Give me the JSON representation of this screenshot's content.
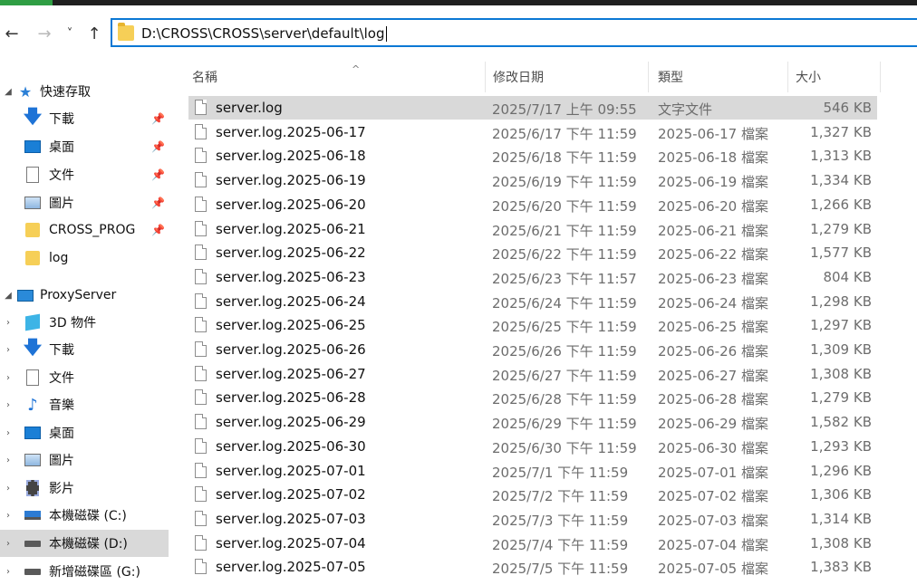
{
  "address": {
    "path": "D:\\CROSS\\CROSS\\server\\default\\log"
  },
  "nav": {
    "back": "←",
    "forward": "→",
    "recent": "˅",
    "up": "↑"
  },
  "columns": {
    "name": "名稱",
    "date": "修改日期",
    "type": "類型",
    "size": "大小"
  },
  "sidebar": {
    "quick_access": "快速存取",
    "quick_items": [
      {
        "label": "下載",
        "icon": "download-icon",
        "pinned": true
      },
      {
        "label": "桌面",
        "icon": "desktop-icon",
        "pinned": true
      },
      {
        "label": "文件",
        "icon": "documents-icon",
        "pinned": true
      },
      {
        "label": "圖片",
        "icon": "pictures-icon",
        "pinned": true
      },
      {
        "label": "CROSS_PROG",
        "icon": "folder-icon",
        "pinned": true
      },
      {
        "label": "log",
        "icon": "folder-icon",
        "pinned": false
      }
    ],
    "this_pc": "ProxyServer",
    "pc_items": [
      {
        "label": "3D 物件",
        "icon": "3d-objects-icon"
      },
      {
        "label": "下載",
        "icon": "download-icon"
      },
      {
        "label": "文件",
        "icon": "documents-icon"
      },
      {
        "label": "音樂",
        "icon": "music-icon"
      },
      {
        "label": "桌面",
        "icon": "desktop-icon"
      },
      {
        "label": "圖片",
        "icon": "pictures-icon"
      },
      {
        "label": "影片",
        "icon": "videos-icon"
      },
      {
        "label": "本機磁碟 (C:)",
        "icon": "drive-c-icon"
      },
      {
        "label": "本機磁碟 (D:)",
        "icon": "drive-icon"
      },
      {
        "label": "新增磁碟區 (G:)",
        "icon": "drive-icon"
      }
    ]
  },
  "files": [
    {
      "name": "server.log",
      "date": "2025/7/17 上午 09:55",
      "type": "文字文件",
      "size": "546 KB"
    },
    {
      "name": "server.log.2025-06-17",
      "date": "2025/6/17 下午 11:59",
      "type": "2025-06-17 檔案",
      "size": "1,327 KB"
    },
    {
      "name": "server.log.2025-06-18",
      "date": "2025/6/18 下午 11:59",
      "type": "2025-06-18 檔案",
      "size": "1,313 KB"
    },
    {
      "name": "server.log.2025-06-19",
      "date": "2025/6/19 下午 11:59",
      "type": "2025-06-19 檔案",
      "size": "1,334 KB"
    },
    {
      "name": "server.log.2025-06-20",
      "date": "2025/6/20 下午 11:59",
      "type": "2025-06-20 檔案",
      "size": "1,266 KB"
    },
    {
      "name": "server.log.2025-06-21",
      "date": "2025/6/21 下午 11:59",
      "type": "2025-06-21 檔案",
      "size": "1,279 KB"
    },
    {
      "name": "server.log.2025-06-22",
      "date": "2025/6/22 下午 11:59",
      "type": "2025-06-22 檔案",
      "size": "1,577 KB"
    },
    {
      "name": "server.log.2025-06-23",
      "date": "2025/6/23 下午 11:57",
      "type": "2025-06-23 檔案",
      "size": "804 KB"
    },
    {
      "name": "server.log.2025-06-24",
      "date": "2025/6/24 下午 11:59",
      "type": "2025-06-24 檔案",
      "size": "1,298 KB"
    },
    {
      "name": "server.log.2025-06-25",
      "date": "2025/6/25 下午 11:59",
      "type": "2025-06-25 檔案",
      "size": "1,297 KB"
    },
    {
      "name": "server.log.2025-06-26",
      "date": "2025/6/26 下午 11:59",
      "type": "2025-06-26 檔案",
      "size": "1,309 KB"
    },
    {
      "name": "server.log.2025-06-27",
      "date": "2025/6/27 下午 11:59",
      "type": "2025-06-27 檔案",
      "size": "1,308 KB"
    },
    {
      "name": "server.log.2025-06-28",
      "date": "2025/6/28 下午 11:59",
      "type": "2025-06-28 檔案",
      "size": "1,279 KB"
    },
    {
      "name": "server.log.2025-06-29",
      "date": "2025/6/29 下午 11:59",
      "type": "2025-06-29 檔案",
      "size": "1,582 KB"
    },
    {
      "name": "server.log.2025-06-30",
      "date": "2025/6/30 下午 11:59",
      "type": "2025-06-30 檔案",
      "size": "1,293 KB"
    },
    {
      "name": "server.log.2025-07-01",
      "date": "2025/7/1 下午 11:59",
      "type": "2025-07-01 檔案",
      "size": "1,296 KB"
    },
    {
      "name": "server.log.2025-07-02",
      "date": "2025/7/2 下午 11:59",
      "type": "2025-07-02 檔案",
      "size": "1,306 KB"
    },
    {
      "name": "server.log.2025-07-03",
      "date": "2025/7/3 下午 11:59",
      "type": "2025-07-03 檔案",
      "size": "1,314 KB"
    },
    {
      "name": "server.log.2025-07-04",
      "date": "2025/7/4 下午 11:59",
      "type": "2025-07-04 檔案",
      "size": "1,308 KB"
    },
    {
      "name": "server.log.2025-07-05",
      "date": "2025/7/5 下午 11:59",
      "type": "2025-07-05 檔案",
      "size": "1,383 KB"
    }
  ]
}
